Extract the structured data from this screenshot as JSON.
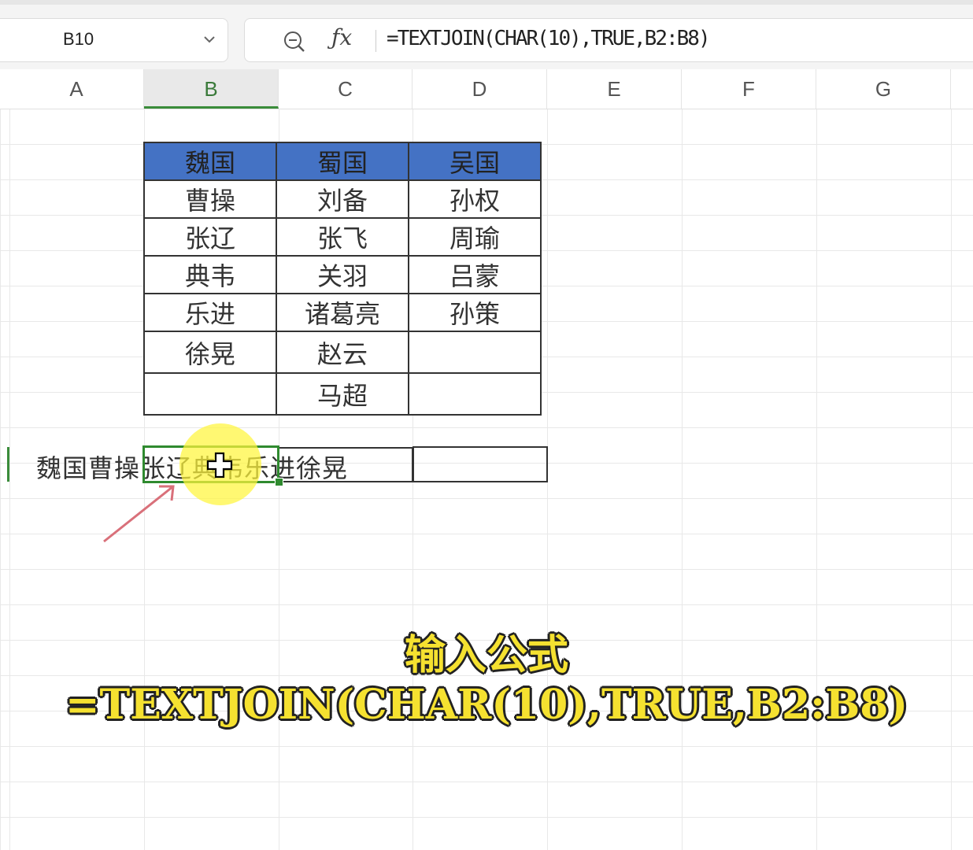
{
  "name_box": {
    "value": "B10"
  },
  "formula_bar": {
    "formula": "=TEXTJOIN(CHAR(10),TRUE,B2:B8)"
  },
  "columns": [
    "A",
    "B",
    "C",
    "D",
    "E",
    "F",
    "G"
  ],
  "selected_column": "B",
  "table": {
    "headers": [
      "魏国",
      "蜀国",
      "吴国"
    ],
    "header_color": "#4472c4",
    "rows": [
      [
        "曹操",
        "刘备",
        "孙权"
      ],
      [
        "张辽",
        "张飞",
        "周瑜"
      ],
      [
        "典韦",
        "关羽",
        "吕蒙"
      ],
      [
        "乐进",
        "诸葛亮",
        "孙策"
      ],
      [
        "徐晃",
        "赵云",
        ""
      ],
      [
        "",
        "马超",
        ""
      ]
    ]
  },
  "result": {
    "text": "魏国曹操张辽典韦乐进徐晃"
  },
  "caption": {
    "text": "输入公式=TEXTJOIN(CHAR(10),TRUE,B2:B8)"
  },
  "accent_color": "#2f8a2f",
  "icons": [
    "chevron-down-icon",
    "zoom-icon",
    "fx-icon",
    "move-cursor-icon",
    "arrow-annotation"
  ]
}
